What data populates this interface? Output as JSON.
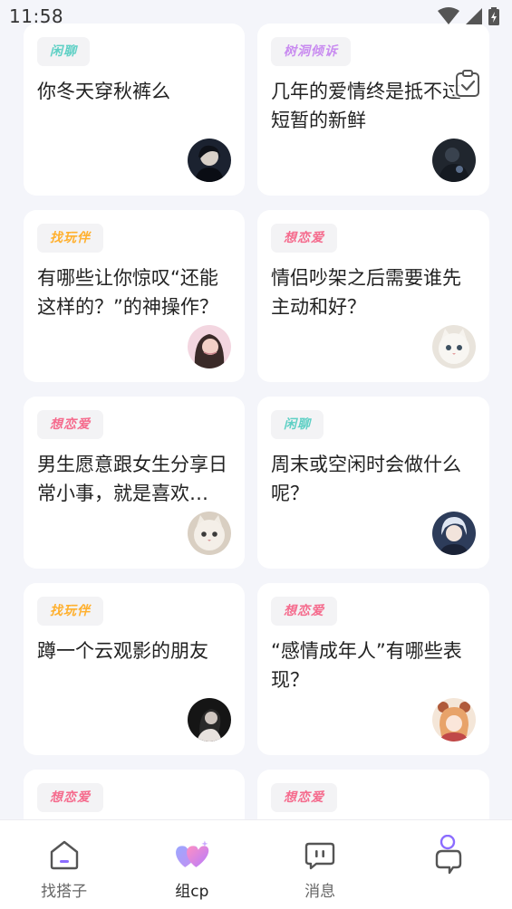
{
  "status_bar": {
    "time": "11:58"
  },
  "colors": {
    "tag_chat": "#5fd0c5",
    "tag_treehole": "#c98cf0",
    "tag_play": "#ffb02e",
    "tag_love": "#f56b8d",
    "tab_active_start": "#ff7fb4",
    "tab_active_end": "#a57cff"
  },
  "cards": [
    {
      "tag": "闲聊",
      "tag_type": "chat",
      "text": "你冬天穿秋裤么",
      "avatar": "dark-boy"
    },
    {
      "tag": "树洞倾诉",
      "tag_type": "treehole",
      "text": "几年的爱情终是抵不过短暂的新鲜",
      "avatar": "night-figure"
    },
    {
      "tag": "找玩伴",
      "tag_type": "play",
      "text": "有哪些让你惊叹“还能这样的？”的神操作？",
      "avatar": "girl-pink"
    },
    {
      "tag": "想恋爱",
      "tag_type": "love",
      "text": "情侣吵架之后需要谁先主动和好？",
      "avatar": "white-cat"
    },
    {
      "tag": "想恋爱",
      "tag_type": "love",
      "text": "男生愿意跟女生分享日常小事，就是喜欢…",
      "avatar": "white-cat-2"
    },
    {
      "tag": "闲聊",
      "tag_type": "chat",
      "text": "周末或空闲时会做什么呢？",
      "avatar": "anime-boy"
    },
    {
      "tag": "找玩伴",
      "tag_type": "play",
      "text": "蹲一个云观影的朋友",
      "avatar": "dark-girl"
    },
    {
      "tag": "想恋爱",
      "tag_type": "love",
      "text": "“感情成年人”有哪些表现？",
      "avatar": "anime-girl-bear"
    },
    {
      "tag": "想恋爱",
      "tag_type": "love",
      "text": "",
      "avatar": ""
    },
    {
      "tag": "想恋爱",
      "tag_type": "love",
      "text": "",
      "avatar": ""
    }
  ],
  "tabs": [
    {
      "label": "找搭子",
      "icon": "home-icon",
      "active": false
    },
    {
      "label": "组cp",
      "icon": "hearts-icon",
      "active": true
    },
    {
      "label": "消息",
      "icon": "message-icon",
      "active": false
    },
    {
      "label": "",
      "icon": "profile-icon",
      "active": false
    }
  ]
}
